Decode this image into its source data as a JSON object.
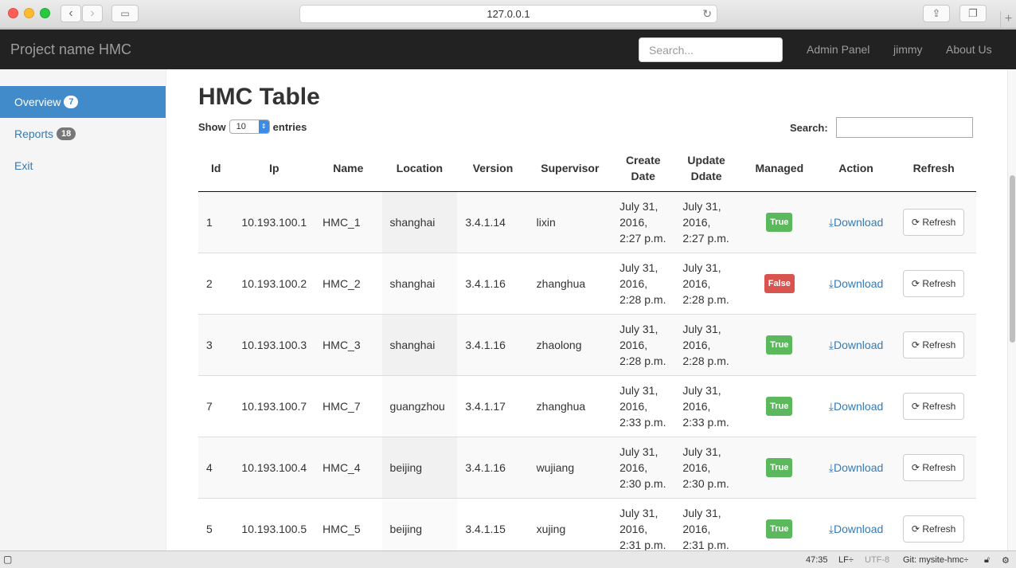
{
  "browser": {
    "url": "127.0.0.1"
  },
  "nav": {
    "brand": "Project name HMC",
    "search_placeholder": "Search...",
    "links": [
      "Admin Panel",
      "jimmy",
      "About Us"
    ]
  },
  "sidebar": {
    "items": [
      {
        "label": "Overview",
        "badge": "7",
        "active": true
      },
      {
        "label": "Reports",
        "badge": "18",
        "active": false
      },
      {
        "label": "Exit",
        "badge": "",
        "active": false
      }
    ]
  },
  "main": {
    "title": "HMC Table",
    "show_label": "Show",
    "entries_value": "10",
    "entries_label": "entries",
    "search_label": "Search:",
    "columns": [
      "Id",
      "Ip",
      "Name",
      "Location",
      "Version",
      "Supervisor",
      "Create Date",
      "Update Ddate",
      "Managed",
      "Action",
      "Refresh"
    ],
    "download_label": "Download",
    "refresh_label": "Refresh",
    "rows": [
      {
        "id": "1",
        "ip": "10.193.100.1",
        "name": "HMC_1",
        "location": "shanghai",
        "version": "3.4.1.14",
        "supervisor": "lixin",
        "create": "July 31, 2016, 2:27 p.m.",
        "update": "July 31, 2016, 2:27 p.m.",
        "managed": "True"
      },
      {
        "id": "2",
        "ip": "10.193.100.2",
        "name": "HMC_2",
        "location": "shanghai",
        "version": "3.4.1.16",
        "supervisor": "zhanghua",
        "create": "July 31, 2016, 2:28 p.m.",
        "update": "July 31, 2016, 2:28 p.m.",
        "managed": "False"
      },
      {
        "id": "3",
        "ip": "10.193.100.3",
        "name": "HMC_3",
        "location": "shanghai",
        "version": "3.4.1.16",
        "supervisor": "zhaolong",
        "create": "July 31, 2016, 2:28 p.m.",
        "update": "July 31, 2016, 2:28 p.m.",
        "managed": "True"
      },
      {
        "id": "7",
        "ip": "10.193.100.7",
        "name": "HMC_7",
        "location": "guangzhou",
        "version": "3.4.1.17",
        "supervisor": "zhanghua",
        "create": "July 31, 2016, 2:33 p.m.",
        "update": "July 31, 2016, 2:33 p.m.",
        "managed": "True"
      },
      {
        "id": "4",
        "ip": "10.193.100.4",
        "name": "HMC_4",
        "location": "beijing",
        "version": "3.4.1.16",
        "supervisor": "wujiang",
        "create": "July 31, 2016, 2:30 p.m.",
        "update": "July 31, 2016, 2:30 p.m.",
        "managed": "True"
      },
      {
        "id": "5",
        "ip": "10.193.100.5",
        "name": "HMC_5",
        "location": "beijing",
        "version": "3.4.1.15",
        "supervisor": "xujing",
        "create": "July 31, 2016, 2:31 p.m.",
        "update": "July 31, 2016, 2:31 p.m.",
        "managed": "True"
      }
    ]
  },
  "statusbar": {
    "position": "47:35",
    "line_ending": "LF÷",
    "encoding": "UTF-8",
    "git": "Git: mysite-hmc÷"
  }
}
